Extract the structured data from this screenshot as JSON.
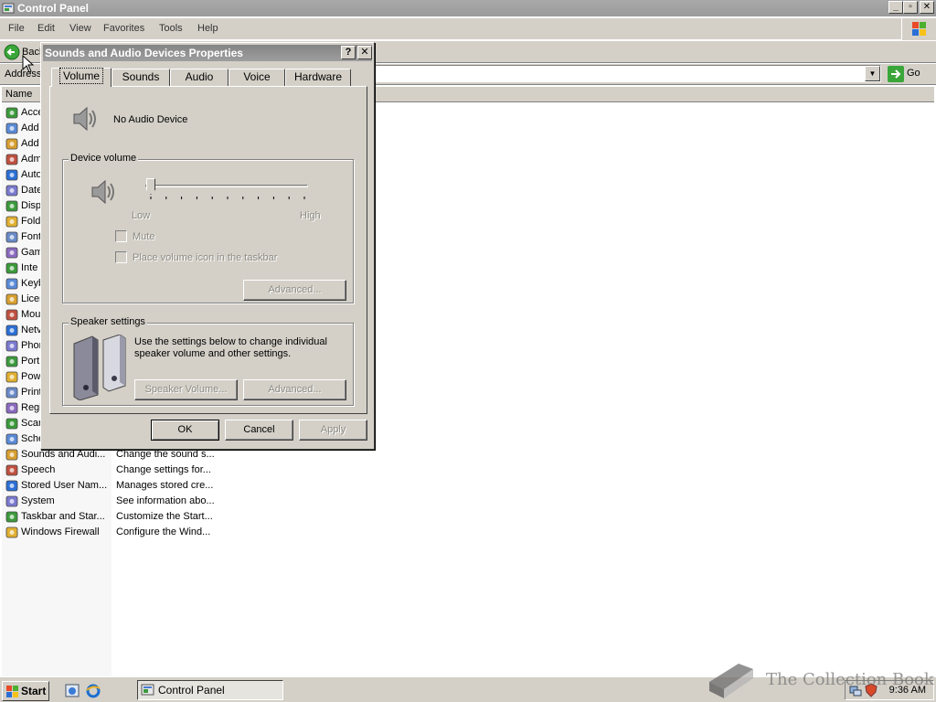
{
  "window": {
    "title": "Control Panel",
    "minimize": "_",
    "maximize": "▫",
    "close": "✕"
  },
  "menu": [
    "File",
    "Edit",
    "View",
    "Favorites",
    "Tools",
    "Help"
  ],
  "toolbar": {
    "back_label": "Back"
  },
  "address": {
    "label": "Address",
    "go_label": "Go",
    "value": ""
  },
  "list": {
    "column_name": "Name",
    "rows": [
      {
        "name": "Acce",
        "desc": "",
        "icon": "accessibility-icon"
      },
      {
        "name": "Add",
        "desc": "",
        "icon": "add-hardware-icon"
      },
      {
        "name": "Add",
        "desc": "",
        "icon": "add-remove-programs-icon"
      },
      {
        "name": "Adm",
        "desc": "",
        "icon": "administrative-tools-icon"
      },
      {
        "name": "Auto",
        "desc": "",
        "icon": "automatic-updates-icon"
      },
      {
        "name": "Date",
        "desc": "",
        "icon": "date-time-icon"
      },
      {
        "name": "Disp",
        "desc": "",
        "icon": "display-icon"
      },
      {
        "name": "Fold",
        "desc": "",
        "icon": "folder-options-icon"
      },
      {
        "name": "Font",
        "desc": "",
        "icon": "fonts-icon"
      },
      {
        "name": "Gam",
        "desc": "",
        "icon": "game-controllers-icon"
      },
      {
        "name": "Inte",
        "desc": "",
        "icon": "internet-options-icon"
      },
      {
        "name": "Keyb",
        "desc": "",
        "icon": "keyboard-icon"
      },
      {
        "name": "Licer",
        "desc": "",
        "icon": "licensing-icon"
      },
      {
        "name": "Mou",
        "desc": "",
        "icon": "mouse-icon"
      },
      {
        "name": "Netv",
        "desc": "",
        "icon": "network-connections-icon"
      },
      {
        "name": "Phor",
        "desc": "",
        "icon": "phone-modem-icon"
      },
      {
        "name": "Port",
        "desc": "",
        "icon": "portable-media-icon"
      },
      {
        "name": "Pow",
        "desc": "",
        "icon": "power-options-icon"
      },
      {
        "name": "Print",
        "desc": "",
        "icon": "printers-icon"
      },
      {
        "name": "Regi",
        "desc": "",
        "icon": "regional-options-icon"
      },
      {
        "name": "Scar",
        "desc": "",
        "icon": "scanners-icon"
      },
      {
        "name": "Sche",
        "desc": "",
        "icon": "scheduled-tasks-icon"
      },
      {
        "name": "Sounds and Audi...",
        "desc": "Change the sound s...",
        "icon": "sounds-audio-icon"
      },
      {
        "name": "Speech",
        "desc": "Change settings for...",
        "icon": "speech-icon"
      },
      {
        "name": "Stored User Nam...",
        "desc": "Manages stored cre...",
        "icon": "stored-user-names-icon"
      },
      {
        "name": "System",
        "desc": "See information abo...",
        "icon": "system-icon"
      },
      {
        "name": "Taskbar and Star...",
        "desc": "Customize the Start...",
        "icon": "taskbar-start-menu-icon"
      },
      {
        "name": "Windows Firewall",
        "desc": "Configure the Wind...",
        "icon": "windows-firewall-icon"
      }
    ]
  },
  "dialog": {
    "title": "Sounds and Audio Devices Properties",
    "help": "?",
    "close": "✕",
    "tabs": [
      "Volume",
      "Sounds",
      "Audio",
      "Voice",
      "Hardware"
    ],
    "device_name": "No Audio Device",
    "device_volume_label": "Device volume",
    "low_label": "Low",
    "high_label": "High",
    "volume_level_percent": 0,
    "mute_label": "Mute",
    "place_icon_label": "Place volume icon in the taskbar",
    "advanced_label": "Advanced...",
    "speaker_settings_label": "Speaker settings",
    "speaker_text": "Use the settings below to change individual speaker volume and other settings.",
    "speaker_volume_label": "Speaker Volume...",
    "speaker_advanced_label": "Advanced...",
    "ok_label": "OK",
    "cancel_label": "Cancel",
    "apply_label": "Apply"
  },
  "taskbar": {
    "start_label": "Start",
    "task_label": "Control Panel",
    "clock": "9:36 AM"
  },
  "watermark": "The Collection Book"
}
